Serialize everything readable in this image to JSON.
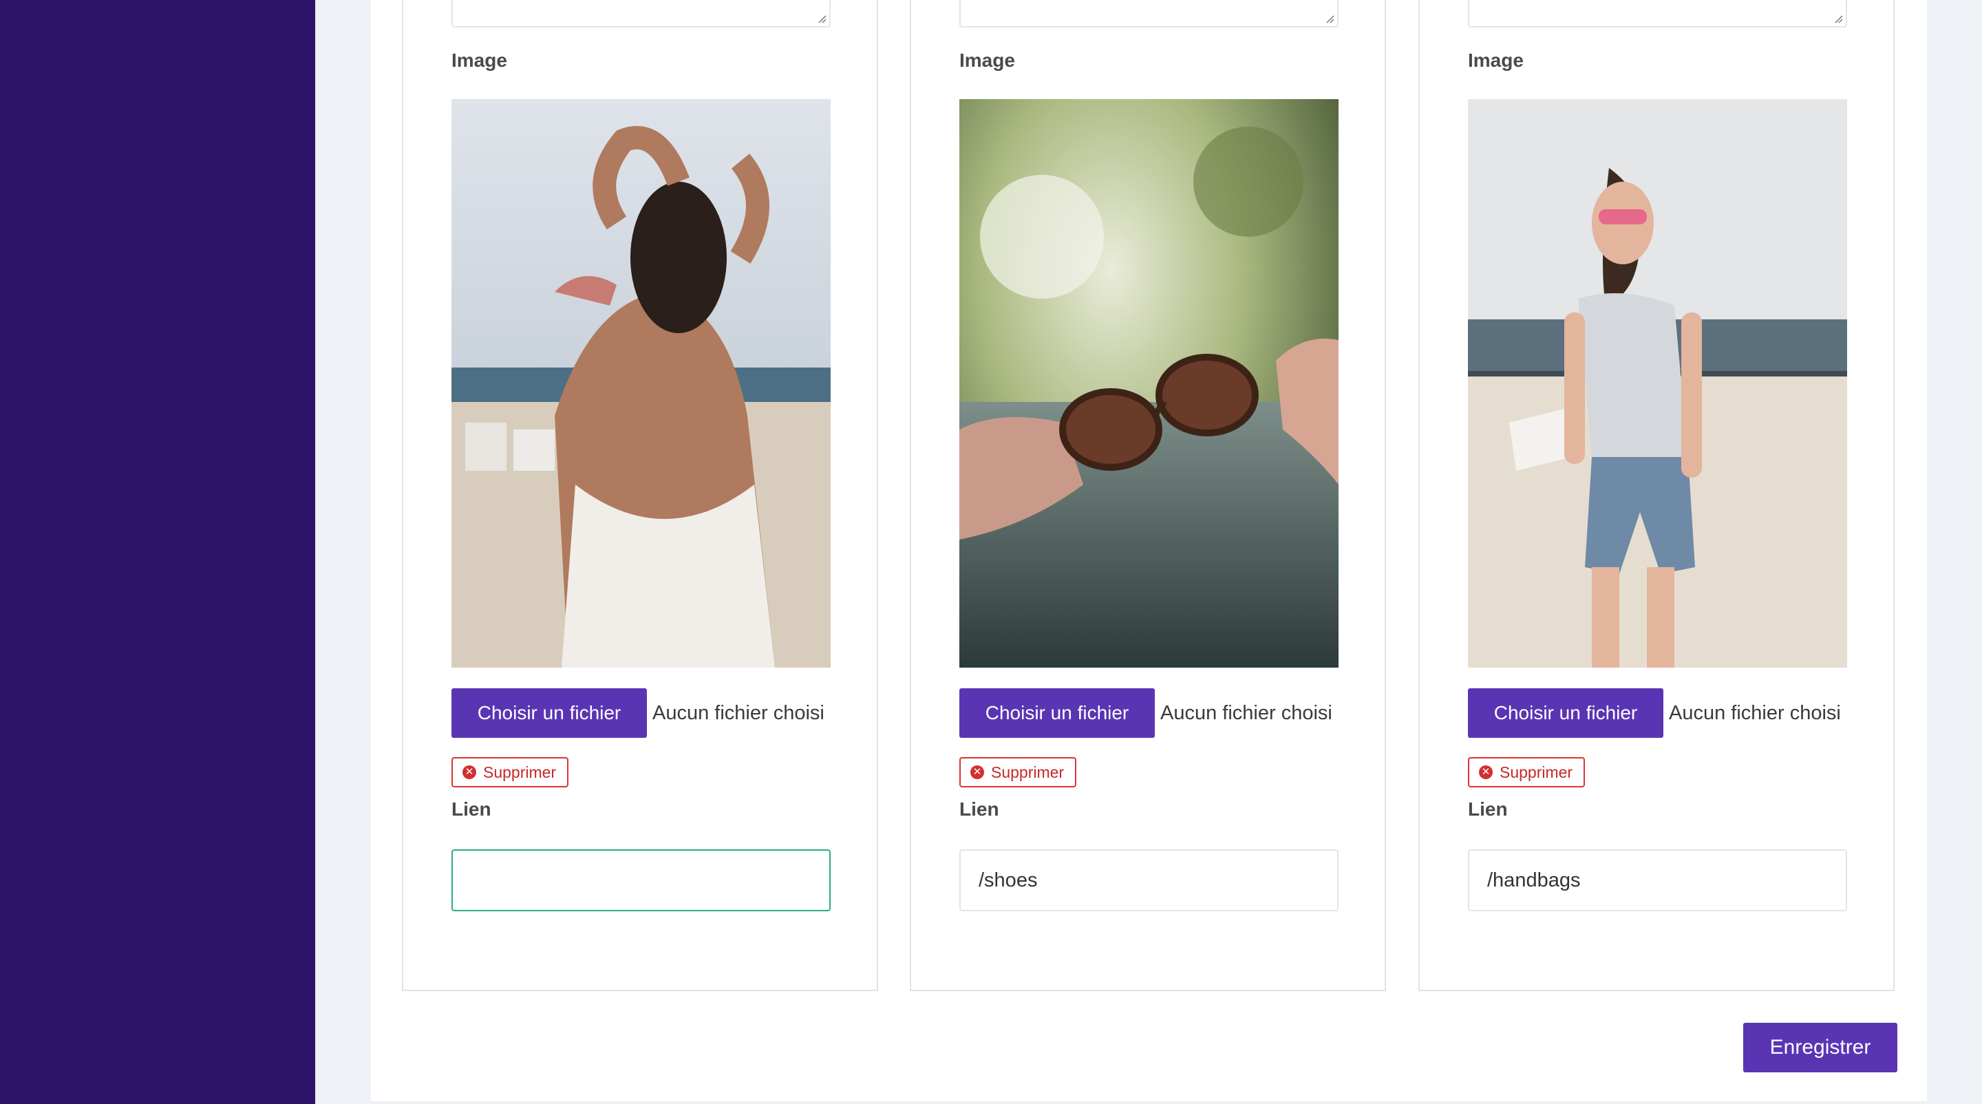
{
  "cards": [
    {
      "image_label": "Image",
      "file_button_label": "Choisir un fichier",
      "file_status": "Aucun fichier choisi",
      "delete_label": "Supprimer",
      "link_label": "Lien",
      "link_value": "",
      "photo_subject": "woman-on-beach-back-view"
    },
    {
      "image_label": "Image",
      "file_button_label": "Choisir un fichier",
      "file_status": "Aucun fichier choisi",
      "delete_label": "Supprimer",
      "link_label": "Lien",
      "link_value": "/shoes",
      "photo_subject": "hands-holding-sunglasses"
    },
    {
      "image_label": "Image",
      "file_button_label": "Choisir un fichier",
      "file_status": "Aucun fichier choisi",
      "delete_label": "Supprimer",
      "link_label": "Lien",
      "link_value": "/handbags",
      "photo_subject": "woman-in-sunglasses-at-beach"
    }
  ],
  "save_label": "Enregistrer",
  "colors": {
    "sidebar": "#2c1468",
    "accent": "#5a35b3",
    "danger": "#d32f2f",
    "focus": "#2eaa88"
  }
}
